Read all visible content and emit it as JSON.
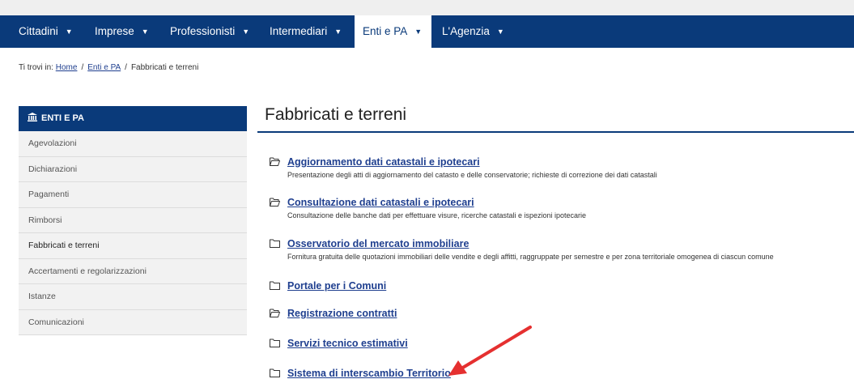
{
  "nav": {
    "items": [
      {
        "label": "Cittadini",
        "active": false
      },
      {
        "label": "Imprese",
        "active": false
      },
      {
        "label": "Professionisti",
        "active": false
      },
      {
        "label": "Intermediari",
        "active": false
      },
      {
        "label": "Enti e PA",
        "active": true
      },
      {
        "label": "L'Agenzia",
        "active": false
      }
    ],
    "caret": "▼"
  },
  "breadcrumb": {
    "prefix": "Ti trovi in:",
    "links": [
      "Home",
      "Enti e PA"
    ],
    "current": "Fabbricati e terreni",
    "separator": "/"
  },
  "sidebar": {
    "header": "ENTI E PA",
    "header_icon": "institution-icon",
    "items": [
      {
        "label": "Agevolazioni",
        "active": false
      },
      {
        "label": "Dichiarazioni",
        "active": false
      },
      {
        "label": "Pagamenti",
        "active": false
      },
      {
        "label": "Rimborsi",
        "active": false
      },
      {
        "label": "Fabbricati e terreni",
        "active": true
      },
      {
        "label": "Accertamenti e regolarizzazioni",
        "active": false
      },
      {
        "label": "Istanze",
        "active": false
      },
      {
        "label": "Comunicazioni",
        "active": false
      }
    ]
  },
  "main": {
    "title": "Fabbricati e terreni",
    "links": [
      {
        "label": "Aggiornamento dati catastali e ipotecari",
        "description": "Presentazione degli atti di aggiornamento del catasto e delle conservatorie; richieste di correzione dei dati catastali",
        "icon": "folder-open-icon"
      },
      {
        "label": "Consultazione dati catastali e ipotecari",
        "description": "Consultazione delle banche dati per effettuare visure, ricerche catastali e ispezioni ipotecarie",
        "icon": "folder-open-icon"
      },
      {
        "label": "Osservatorio del mercato immobiliare",
        "description": "Fornitura gratuita delle quotazioni immobiliari delle vendite e degli affitti, raggruppate per semestre e per zona territoriale omogenea di ciascun comune",
        "icon": "folder-icon"
      },
      {
        "label": "Portale per i Comuni",
        "description": "",
        "icon": "folder-icon"
      },
      {
        "label": "Registrazione contratti",
        "description": "",
        "icon": "folder-open-icon"
      },
      {
        "label": "Servizi tecnico estimativi",
        "description": "",
        "icon": "folder-icon"
      },
      {
        "label": "Sistema di interscambio Territorio",
        "description": "",
        "icon": "folder-icon"
      }
    ]
  },
  "colors": {
    "nav_bg": "#0a3a7a",
    "link": "#1f3f8f",
    "annotation_arrow": "#e53030"
  }
}
